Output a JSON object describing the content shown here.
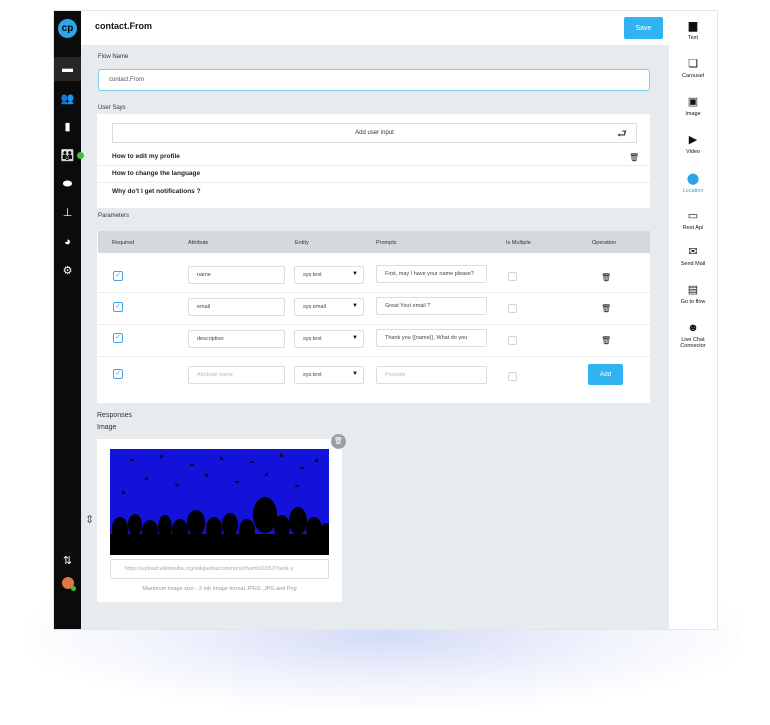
{
  "header": {
    "title": "contact.From",
    "save_label": "Save"
  },
  "logo_text": "cp",
  "left_nav": [
    {
      "icon": "chat-icon",
      "glyph": "▬"
    },
    {
      "icon": "users-icon",
      "glyph": "👥"
    },
    {
      "icon": "book-icon",
      "glyph": "▮"
    },
    {
      "icon": "team-icon",
      "glyph": "👪"
    },
    {
      "icon": "bot-icon",
      "glyph": "⬬"
    },
    {
      "icon": "sitemap-icon",
      "glyph": "⊥"
    },
    {
      "icon": "analytics-icon",
      "glyph": "◕"
    },
    {
      "icon": "settings-icon",
      "glyph": "⚙"
    }
  ],
  "flow_name": {
    "label": "Flow Name",
    "value": "contact.From"
  },
  "user_says": {
    "label": "User Says",
    "add_input_label": "Add user input",
    "items": [
      "How to edit my profile",
      "How to change the language",
      "Why do't I get notifications ?"
    ]
  },
  "parameters": {
    "label": "Parameters",
    "columns": [
      "Required",
      "Attribute",
      "Entity",
      "Prompts",
      "Is Multiple",
      "Operation"
    ],
    "rows": [
      {
        "attribute": "name",
        "entity": "sys.text",
        "prompt": "First, may I have your name please?"
      },
      {
        "attribute": "email",
        "entity": "sys.email",
        "prompt": "Great Yout email ?"
      },
      {
        "attribute": "description",
        "entity": "sys.text",
        "prompt": "Thank you {{name}}, What do you"
      }
    ],
    "new_row": {
      "attribute_placeholder": "Attribute name",
      "entity": "sys.text",
      "prompt_placeholder": "Prompts",
      "add_label": "Add"
    }
  },
  "responses": {
    "label": "Responses",
    "type_label": "Image",
    "image_url": "https://upload.wikimedia.org/wikipedia/commons/thumb/2/25/Thank-y",
    "hint": "Maximum image size - 2 mb Image format JPEG ,JPG and Png"
  },
  "right_tools": [
    {
      "label": "Text",
      "icon": "text-file-icon",
      "glyph": "▆"
    },
    {
      "label": "Carousel",
      "icon": "carousel-icon",
      "glyph": "❏"
    },
    {
      "label": "Image",
      "icon": "image-icon",
      "glyph": "▣"
    },
    {
      "label": "Video",
      "icon": "video-icon",
      "glyph": "▶"
    },
    {
      "label": "Location",
      "icon": "location-pin-icon",
      "glyph": "⬤"
    },
    {
      "label": "Rest Api",
      "icon": "api-icon",
      "glyph": "▭"
    },
    {
      "label": "Send Mail",
      "icon": "mail-icon",
      "glyph": "✉"
    },
    {
      "label": "Go to flow",
      "icon": "goto-flow-icon",
      "glyph": "▤"
    },
    {
      "label": "Live Chat Connector",
      "icon": "agent-icon",
      "glyph": "☻"
    }
  ],
  "colors": {
    "accent": "#2fb3f2",
    "sidebar": "#0b0b0b",
    "canvas": "#e8ebee",
    "image_blue": "#1212d8"
  }
}
